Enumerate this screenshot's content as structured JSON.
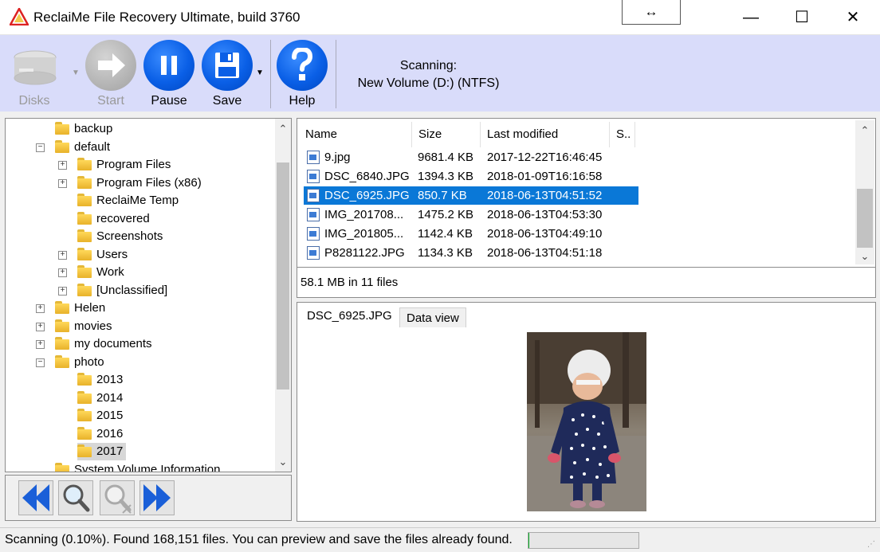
{
  "window": {
    "title": "ReclaiMe File Recovery Ultimate, build 3760",
    "resize_glyph": "↔",
    "minimize_glyph": "—",
    "maximize_glyph": "☐",
    "close_glyph": "✕"
  },
  "toolbar": {
    "disks_label": "Disks",
    "start_label": "Start",
    "pause_label": "Pause",
    "save_label": "Save",
    "help_label": "Help",
    "scan_title": "Scanning:",
    "scan_target": "New Volume (D:) (NTFS)"
  },
  "tree": {
    "items": [
      {
        "label": "backup",
        "level": 1,
        "expander": ""
      },
      {
        "label": "default",
        "level": 1,
        "expander": "−"
      },
      {
        "label": "Program Files",
        "level": 2,
        "expander": "+"
      },
      {
        "label": "Program Files (x86)",
        "level": 2,
        "expander": "+"
      },
      {
        "label": "ReclaiMe Temp",
        "level": 2,
        "expander": ""
      },
      {
        "label": "recovered",
        "level": 2,
        "expander": ""
      },
      {
        "label": "Screenshots",
        "level": 2,
        "expander": ""
      },
      {
        "label": "Users",
        "level": 2,
        "expander": "+"
      },
      {
        "label": "Work",
        "level": 2,
        "expander": "+"
      },
      {
        "label": "[Unclassified]",
        "level": 2,
        "expander": "+"
      },
      {
        "label": "Helen",
        "level": 1,
        "expander": "+"
      },
      {
        "label": "movies",
        "level": 1,
        "expander": "+"
      },
      {
        "label": "my documents",
        "level": 1,
        "expander": "+"
      },
      {
        "label": "photo",
        "level": 1,
        "expander": "−"
      },
      {
        "label": "2013",
        "level": 2,
        "expander": ""
      },
      {
        "label": "2014",
        "level": 2,
        "expander": ""
      },
      {
        "label": "2015",
        "level": 2,
        "expander": ""
      },
      {
        "label": "2016",
        "level": 2,
        "expander": ""
      },
      {
        "label": "2017",
        "level": 2,
        "expander": ""
      },
      {
        "label": "System Volume Information",
        "level": 1,
        "expander": ""
      }
    ],
    "selected": "2017"
  },
  "file_list": {
    "columns": [
      "Name",
      "Size",
      "Last modified",
      "S.."
    ],
    "rows": [
      {
        "name": "9.jpg",
        "size": "9681.4 KB",
        "modified": "2017-12-22T16:46:45"
      },
      {
        "name": "DSC_6840.JPG",
        "size": "1394.3 KB",
        "modified": "2018-01-09T16:16:58"
      },
      {
        "name": "DSC_6925.JPG",
        "size": "850.7 KB",
        "modified": "2018-06-13T04:51:52"
      },
      {
        "name": "IMG_201708...",
        "size": "1475.2 KB",
        "modified": "2018-06-13T04:53:30"
      },
      {
        "name": "IMG_201805...",
        "size": "1142.4 KB",
        "modified": "2018-06-13T04:49:10"
      },
      {
        "name": "P8281122.JPG",
        "size": "1134.3 KB",
        "modified": "2018-06-13T04:51:18"
      }
    ],
    "selected": "DSC_6925.JPG",
    "summary": "58.1 MB in 11 files"
  },
  "preview": {
    "tab_active": "DSC_6925.JPG",
    "tab_inactive": "Data view"
  },
  "status": {
    "text": "Scanning (0.10%). Found 168,151 files. You can preview and save the files already found.",
    "progress_fraction": 0.001
  },
  "colors": {
    "toolbar_bg": "#d9dcfa",
    "accent_blue": "#0a5fe6",
    "selection": "#0a78d7",
    "folder_yellow": "#ffd85a"
  }
}
